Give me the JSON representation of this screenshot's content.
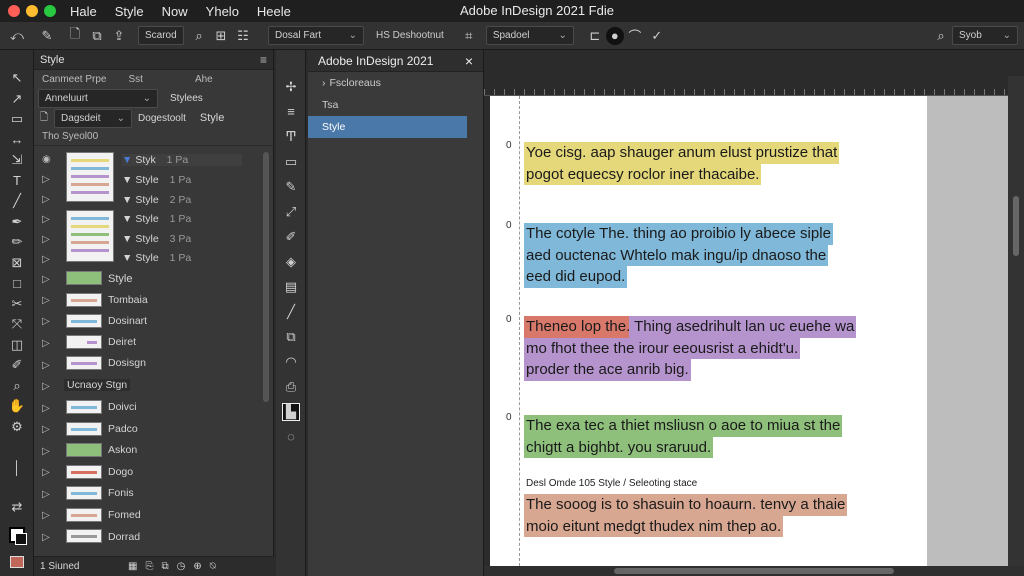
{
  "window": {
    "title": "Adobe InDesign 2021 Fdie",
    "menu": [
      "Hale",
      "Style",
      "Now",
      "Yhelo",
      "Heele"
    ],
    "traffic_colors": [
      "#ff5f57",
      "#febc2e",
      "#28c840"
    ]
  },
  "control_bar": {
    "search_field": "Scarod",
    "style_field": "Dosal Fart",
    "label": "HS Deshootnut",
    "spread_field": "Spadoel",
    "zoom_field": "Syob"
  },
  "styles_panel": {
    "title": "Style",
    "columns": [
      "Canmeet Prpe",
      "Sst",
      "Ahe"
    ],
    "dropdown1": "Anneluurt",
    "dropdown1_label": "Stylees",
    "dropdown2": "Dagsdeit",
    "dropdown2_label": "Dogestoolt",
    "dropdown2_right": "Style",
    "subhead": "Tho Syeol00",
    "top_items": [
      {
        "label": "Styk",
        "value": "1 Pa"
      },
      {
        "label": "Style",
        "value": "1 Pa"
      },
      {
        "label": "Style",
        "value": "2 Pa"
      },
      {
        "label": "Style",
        "value": "1 Pa"
      },
      {
        "label": "Style",
        "value": "3 Pa"
      },
      {
        "label": "Style",
        "value": "1 Pa"
      }
    ],
    "items": [
      "Style",
      "Tombaia",
      "Dosinart",
      "Deiret",
      "Dosisgn",
      "Ucnaoy Stgn",
      "Doivci",
      "Padco",
      "Askon",
      "Dogo",
      "Fonis",
      "Fomed",
      "Dorrad"
    ],
    "footer": "1 Siuned"
  },
  "paragraph_popup": {
    "title": "Adobe InDesign 2021",
    "items": [
      "Fscloreaus",
      "Tsa",
      "Style"
    ]
  },
  "document": {
    "paragraphs": [
      {
        "color": "#e4d87a",
        "lines": [
          "Yoe cisg. aap shauger anum elust prustize that",
          "pogot equecsy roclor iner thacaibe."
        ]
      },
      {
        "color": "#7fb8d8",
        "lines": [
          "The cotyle The. thing ao proibio ly abece siple",
          "aed ouctenac Whtelo mak ingu/ip dnaoso the",
          "eed did eupod."
        ]
      },
      {
        "color": "#b593cd",
        "lines": [
          "Theneo lop the. Thing asedrihult lan uc euehe wa",
          "mo fhot thee the irour eeousrist a ehidt'u.",
          "proder the ace anrib big."
        ]
      },
      {
        "color": "#8ec07c",
        "lines": [
          "The exa tec a thiet msliusn o aoe to miua st the",
          "chigtt a bighbt. you sraruud."
        ]
      },
      {
        "color": "#d8a792",
        "lines": [
          "The sooog is to shasuin to hoaurn. tenvy a thaie",
          "moio eitunt medgt thudex nim thep ao."
        ]
      }
    ],
    "caption": "Desl Omde 105 Style / Seleoting stace"
  }
}
